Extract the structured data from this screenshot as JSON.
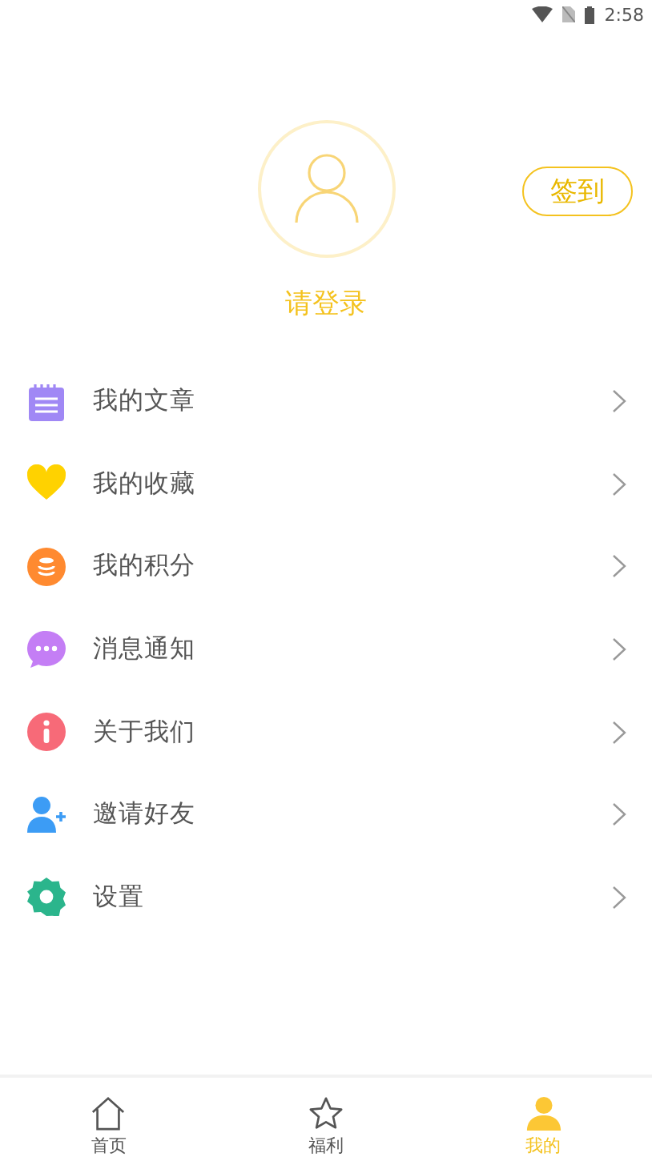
{
  "status_bar": {
    "time": "2:58"
  },
  "profile": {
    "login_prompt": "请登录",
    "checkin_button": "签到"
  },
  "menu": [
    {
      "kind": "notepad",
      "label": "我的文章"
    },
    {
      "kind": "heart",
      "label": "我的收藏"
    },
    {
      "kind": "coins",
      "label": "我的积分"
    },
    {
      "kind": "chat",
      "label": "消息通知"
    },
    {
      "kind": "info",
      "label": "关于我们"
    },
    {
      "kind": "invite",
      "label": "邀请好友"
    },
    {
      "kind": "settings",
      "label": "设置"
    }
  ],
  "tab_bar": [
    {
      "kind": "home",
      "label": "首页",
      "selected": false
    },
    {
      "kind": "star",
      "label": "福利",
      "selected": false
    },
    {
      "kind": "user",
      "label": "我的",
      "selected": true
    }
  ]
}
